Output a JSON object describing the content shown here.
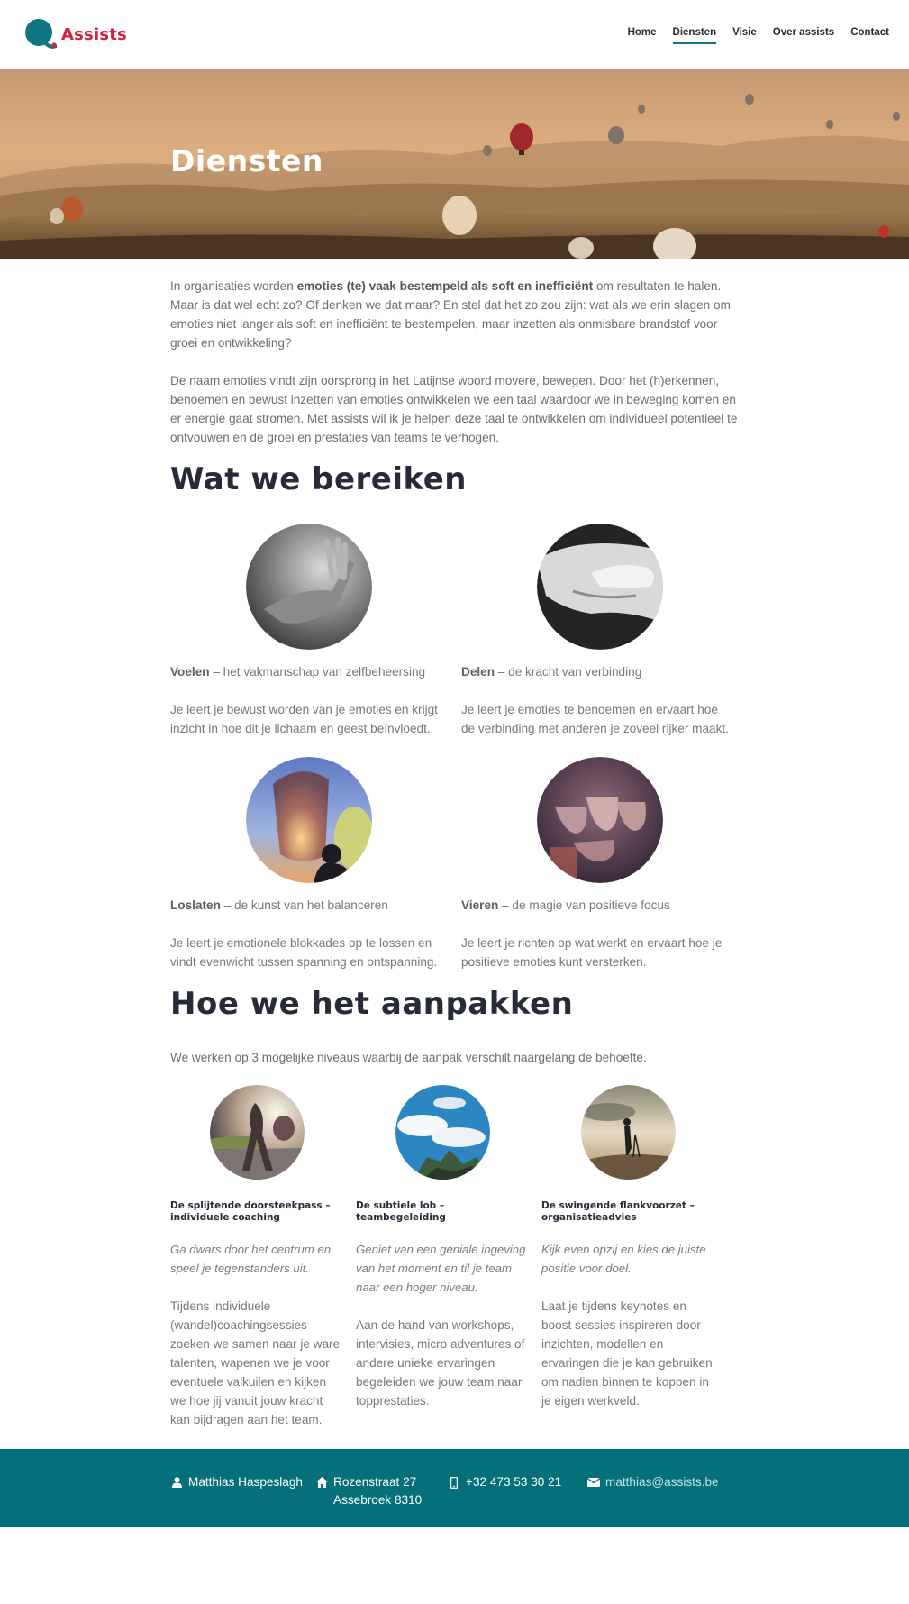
{
  "brand": {
    "name": "Assists",
    "primary_color": "#d6203c",
    "teal_color": "#06707a"
  },
  "nav": [
    {
      "label": "Home",
      "active": false
    },
    {
      "label": "Diensten",
      "active": true
    },
    {
      "label": "Visie",
      "active": false
    },
    {
      "label": "Over assists",
      "active": false
    },
    {
      "label": "Contact",
      "active": false
    }
  ],
  "hero": {
    "title": "Diensten"
  },
  "intro": {
    "p1_before": "In organisaties worden ",
    "p1_bold": "emoties (te) vaak bestempeld als soft en inefficiënt",
    "p1_after": " om resultaten te halen. Maar is dat wel echt zo? Of denken we dat maar? En stel dat het zo zou zijn: wat als we erin slagen om emoties niet langer als soft en inefficiënt te bestempelen, maar inzetten als onmisbare brandstof voor groei en ontwikkeling?",
    "p2": "De naam emoties vindt zijn oorsprong in het Latijnse woord movere, bewegen. Door het (h)erkennen, benoemen en bewust inzetten van emoties ontwikkelen we een taal waardoor we in beweging komen en er energie gaat stromen. Met assists wil ik je helpen deze taal te ontwikkelen om individueel potentieel te ontvouwen en de groei en prestaties van teams te verhogen."
  },
  "section1": {
    "heading": "Wat we bereiken",
    "features": [
      {
        "name": "Voelen",
        "subtitle": " – het vakmanschap van zelfbeheersing",
        "desc": "Je leert je bewust worden van je emoties en krijgt inzicht in hoe dit je lichaam en geest beïnvloedt.",
        "image": "hand-water-photo"
      },
      {
        "name": "Delen",
        "subtitle": " – de kracht van verbinding",
        "desc": "Je leert je emoties te benoemen en ervaart hoe de verbinding met anderen je zoveel rijker maakt.",
        "image": "hands-baby-photo"
      },
      {
        "name": "Loslaten",
        "subtitle": " – de kunst van het balanceren",
        "desc": "Je leert je emotionele blokkades op te lossen en vindt evenwicht tussen spanning en ontspanning.",
        "image": "sky-lantern-photo"
      },
      {
        "name": "Vieren",
        "subtitle": " – de magie van positieve focus",
        "desc": "Je leert je richten op wat werkt en ervaart hoe je positieve emoties kunt versterken.",
        "image": "wine-toast-photo"
      }
    ]
  },
  "section2": {
    "heading": "Hoe we het aanpakken",
    "intro": "We werken op 3 mogelijke niveaus waarbij de aanpak verschilt naargelang de behoefte.",
    "levels": [
      {
        "title": "De splijtende doorsteekpass – individuele coaching",
        "quote": "Ga dwars door het centrum en speel je tegenstanders uit.",
        "desc": "Tijdens individuele (wandel)coachingsessies zoeken we samen naar je ware talenten, wapenen we je voor eventuele valkuilen en kijken we hoe jij vanuit jouw kracht kan bijdragen aan het team.",
        "image": "walking-person-photo"
      },
      {
        "title": "De subtiele lob – teambegeleiding",
        "quote": "Geniet van een geniale ingeving van het moment en til je team naar een hoger niveau.",
        "desc": "Aan de hand van workshops, intervisies, micro adventures of andere unieke ervaringen begeleiden we jouw team naar topprestaties.",
        "image": "sky-clouds-photo"
      },
      {
        "title": "De swingende flankvoorzet – organisatieadvies",
        "quote": "Kijk even opzij en kies de juiste positie voor doel.",
        "desc": "Laat je tijdens keynotes en boost sessies inspireren door inzichten, modellen en ervaringen die je kan gebruiken om nadien binnen te koppen in je eigen werkveld.",
        "image": "photographer-hill-photo"
      }
    ]
  },
  "footer": {
    "name": "Matthias Haspeslagh",
    "address_line1": "Rozenstraat 27",
    "address_line2": "Assebroek 8310",
    "phone": "+32 473 53 30 21",
    "email": "matthias@assists.be",
    "icons": [
      "user-icon",
      "home-icon",
      "mobile-icon",
      "envelope-icon"
    ]
  }
}
